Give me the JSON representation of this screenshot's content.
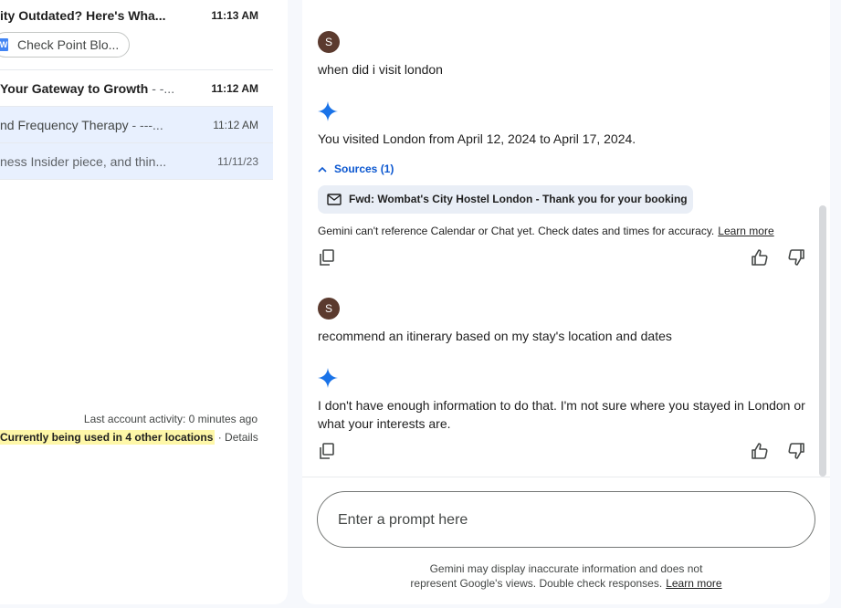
{
  "inbox": {
    "rows": [
      {
        "subject": "ity Outdated? Here's Wha...",
        "snippet": "",
        "time": "11:13 AM"
      },
      {
        "subject": "Your Gateway to Growth",
        "snippet": " - -...",
        "time": "11:12 AM"
      },
      {
        "subject": "nd Frequency Therapy",
        "snippet": " - ---...",
        "time": "11:12 AM"
      },
      {
        "subject": "",
        "snippet": "ness Insider piece, and thin...",
        "time": "11/11/23"
      }
    ],
    "attachment_chip": {
      "icon": "W",
      "label": "Check Point Blo..."
    },
    "last_activity": "Last account activity: 0 minutes ago",
    "locations_highlight": "Currently being used in 4 other locations",
    "locations_separator": " · ",
    "details_link": "Details"
  },
  "gemini": {
    "messages": [
      {
        "role": "user",
        "avatar": "S",
        "text": "when did i visit london"
      },
      {
        "role": "model",
        "text": "You visited London from April 12, 2024 to April 17, 2024."
      },
      {
        "role": "user",
        "avatar": "S",
        "text": "recommend an itinerary based on my stay's location and dates"
      },
      {
        "role": "model",
        "text": "I don't have enough information to do that. I'm not sure where you stayed in London or what your interests are."
      }
    ],
    "sources_label": "Sources (1)",
    "source_title": "Fwd: Wombat's City Hostel London - Thank you for your booking",
    "notice_text": "Gemini can't reference Calendar or Chat yet. Check dates and times for accuracy.",
    "learn_more": "Learn more",
    "prompt_placeholder": "Enter a prompt here",
    "footer_text": "Gemini may display inaccurate information and does not",
    "footer_text2": "represent Google's views. Double check responses.",
    "footer_link": "Learn more",
    "colors": {
      "accent": "#0b57d0",
      "spark": "#1a73e8",
      "highlight": "#fef7a8",
      "selected_row": "#e8f0fe"
    }
  }
}
